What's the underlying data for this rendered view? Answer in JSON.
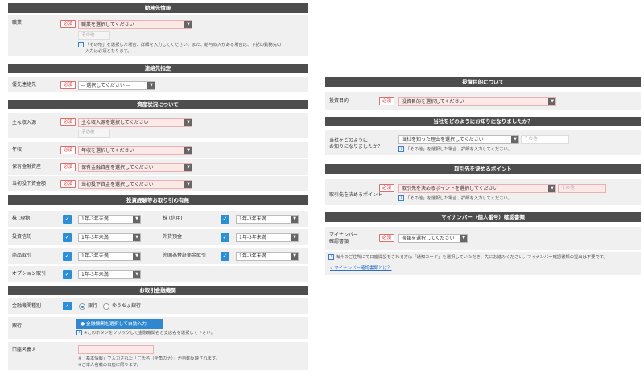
{
  "left": {
    "work_header": "勤務先情報",
    "occupation": {
      "label": "職業",
      "required": "必須",
      "select": "職業を選択してください",
      "other_placeholder": "その他",
      "note1": "「その他」を選択した場合、詳細を入力してください。また、給与収入がある場合は、下記の勤務先の",
      "note2": "入力は必須となります。"
    },
    "contact_header": "連絡先指定",
    "contact": {
      "label": "優先連絡先",
      "required": "必須",
      "select": "-- 選択してください --"
    },
    "assets_header": "資産状況について",
    "income": {
      "label": "主な収入源",
      "required": "必須",
      "select": "主な収入源を選択してください",
      "other_placeholder": "その他"
    },
    "annual": {
      "label": "年収",
      "required": "必須",
      "select": "年収を選択してください"
    },
    "financial": {
      "label": "保有金融資産",
      "required": "必須",
      "select": "保有金融資産を選択してください"
    },
    "investable": {
      "label": "当初投下資金額",
      "required": "必須",
      "select": "当初投下資金を選択してください"
    },
    "experience_header": "投資経験等お取り引の有無",
    "experience": [
      {
        "label": "株 (現物)",
        "value": "1年-3年未満",
        "label2": "株 (信用)",
        "value2": "1年-3年未満"
      },
      {
        "label": "投資信託",
        "value": "1年-3年未満",
        "label2": "外貨預金",
        "value2": "1年-3年未満"
      },
      {
        "label": "商品取引",
        "value": "1年-3年未満",
        "label2": "外国為替証拠金取引",
        "value2": "1年-3年未満"
      },
      {
        "label": "オプション取引",
        "value": "1年-3年未満"
      }
    ],
    "bank_header": "お取引金融機関",
    "bank_type": {
      "label": "金融機関種別",
      "option1": "銀行",
      "option2": "ゆうちょ銀行"
    },
    "bank": {
      "label": "銀行",
      "button": "金融機関を選択して自動入力",
      "note": "※このボタンをクリックして金融機関名と支店名を選択して下さい。"
    },
    "account": {
      "label": "口座名義人",
      "note1": "※「基本情報」で入力された「ご氏名（全角カナ）」が自動反映されます。",
      "note2": "※ご本人名義の口座に限ります。"
    }
  },
  "right": {
    "purpose_header": "投資目的について",
    "purpose": {
      "label": "投資目的",
      "required": "必須",
      "select": "投資目的を選択してください"
    },
    "source_header": "当社をどのようにお知りになりましたか？",
    "source": {
      "label1": "当社をどのように",
      "label2": "お知りになりましたか？",
      "select": "当社を知った理由を選択してください",
      "other_placeholder": "その他",
      "note": "「その他」を選択した場合、詳細を入力してください。"
    },
    "point_header": "取引先を決めるポイント",
    "point": {
      "label": "取引先を決めるポイント",
      "required": "必須",
      "select": "取引先を決めるポイントを選択してください",
      "other_placeholder": "その他",
      "note": "「その他」を選択した場合、詳細を入力してください。"
    },
    "mynumber_header": "マイナンバー（個人番号）確認書類",
    "mynumber": {
      "label1": "マイナンバー",
      "label2": "確認書類",
      "required": "必須",
      "select": "書類を選択してください",
      "note": "海外のご住所にて口座開設をされる方は「通知カード」を選択していただき、先にお進みください。マイナンバー確認書類の提出は不要です。",
      "link": "マイナンバー確認書類とは？"
    }
  },
  "icons": {
    "arrow": "▼",
    "check": "✓",
    "info": "i",
    "bullet": "●",
    "link_arrow": "»"
  }
}
